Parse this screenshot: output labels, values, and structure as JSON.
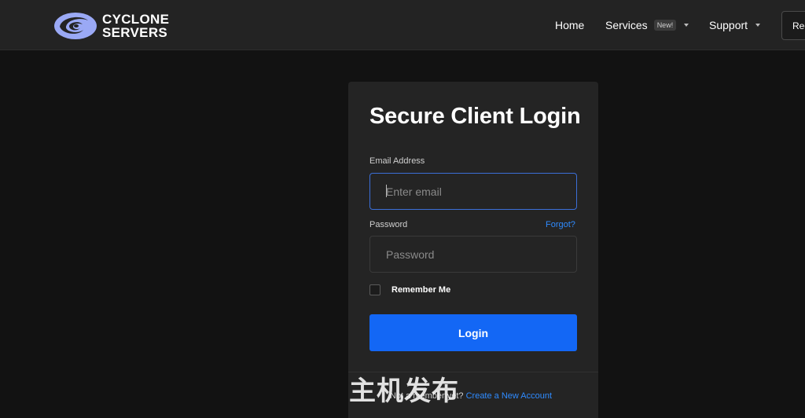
{
  "brand": {
    "line1": "CYCLONE",
    "line2": "SERVERS",
    "logo_icon": "cyclone-logo-icon",
    "logo_color": "#9aa9f5"
  },
  "nav": {
    "home": "Home",
    "services": "Services",
    "services_badge": "New!",
    "support": "Support",
    "register": "Reg"
  },
  "login": {
    "title": "Secure Client Login",
    "email_label": "Email Address",
    "email_placeholder": "Enter email",
    "password_label": "Password",
    "forgot_link": "Forgot?",
    "password_placeholder": "Password",
    "remember_label": "Remember Me",
    "login_button": "Login",
    "footer_text": "Not a member yet?",
    "create_account_link": "Create a New Account"
  },
  "watermark": "主机发布",
  "colors": {
    "accent": "#1367f5",
    "link": "#2f8bff",
    "background": "#121212",
    "card": "#242424",
    "navbar": "#232323"
  }
}
